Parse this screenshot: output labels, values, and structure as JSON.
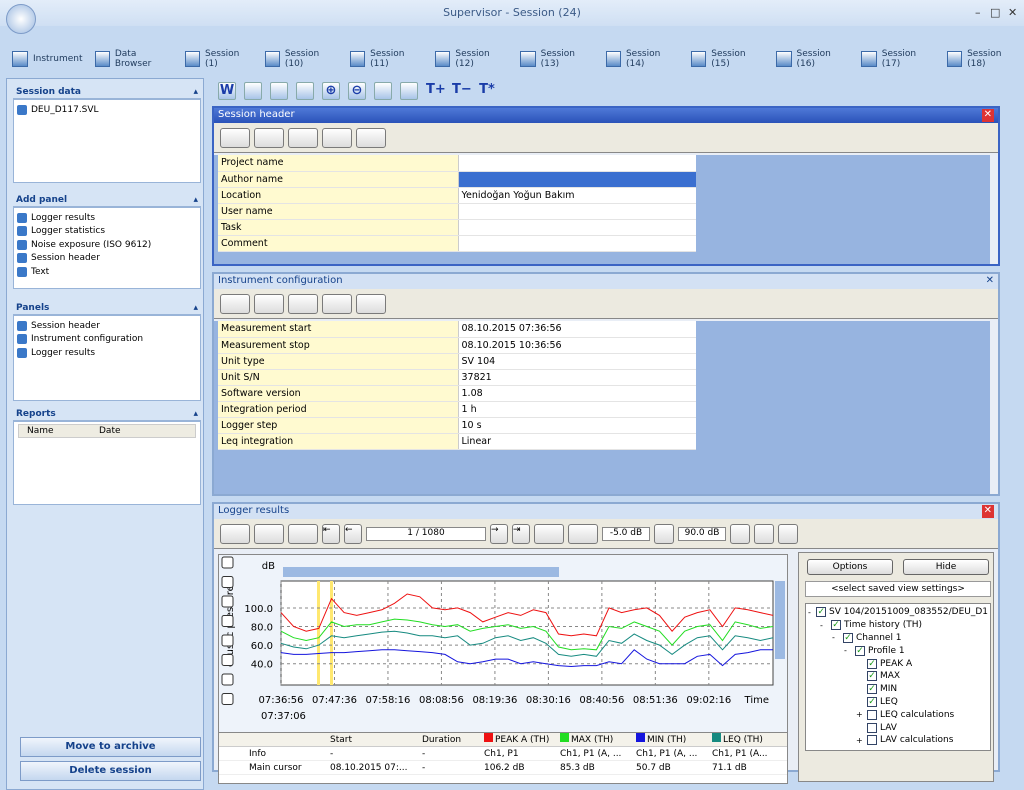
{
  "window": {
    "title": "Supervisor - Session (24)"
  },
  "tabs": [
    "Instrument",
    "Data Browser",
    "Session (1)",
    "Session (10)",
    "Session (11)",
    "Session (12)",
    "Session (13)",
    "Session (14)",
    "Session (15)",
    "Session (16)",
    "Session (17)",
    "Session (18)"
  ],
  "left": {
    "session_data": {
      "title": "Session data",
      "items": [
        "DEU_D117.SVL"
      ]
    },
    "add_panel": {
      "title": "Add panel",
      "items": [
        "Logger results",
        "Logger statistics",
        "Noise exposure (ISO 9612)",
        "Session header",
        "Text"
      ]
    },
    "panels": {
      "title": "Panels",
      "items": [
        "Session header",
        "Instrument configuration",
        "Logger results"
      ]
    },
    "reports": {
      "title": "Reports",
      "columns": [
        "Name",
        "Date"
      ]
    },
    "move_to_archive": "Move to archive",
    "delete_session": "Delete session"
  },
  "session_header": {
    "title": "Session header",
    "rows": [
      [
        "Project name",
        ""
      ],
      [
        "Author name",
        ""
      ],
      [
        "Location",
        "Yenidoğan Yoğun Bakım"
      ],
      [
        "User name",
        ""
      ],
      [
        "Task",
        ""
      ],
      [
        "Comment",
        ""
      ]
    ]
  },
  "instrument_config": {
    "title": "Instrument configuration",
    "rows": [
      [
        "Measurement start",
        "08.10.2015 07:36:56"
      ],
      [
        "Measurement stop",
        "08.10.2015 10:36:56"
      ],
      [
        "Unit type",
        "SV 104"
      ],
      [
        "Unit S/N",
        "37821"
      ],
      [
        "Software version",
        "1.08"
      ],
      [
        "Integration period",
        "1 h"
      ],
      [
        "Logger step",
        "10 s"
      ],
      [
        "Leq integration",
        "Linear"
      ]
    ]
  },
  "logger_results": {
    "title": "Logger results",
    "page": "1 / 1080",
    "min_db": "-5.0 dB",
    "max_db": "90.0 dB",
    "options": "Options",
    "hide": "Hide",
    "saved_view": "<select saved view settings>",
    "tree": [
      {
        "label": "SV 104/20151009_083552/DEU_D1",
        "level": 0,
        "checked": true,
        "exp": "-"
      },
      {
        "label": "Time history (TH)",
        "level": 1,
        "checked": true,
        "exp": "-"
      },
      {
        "label": "Channel 1",
        "level": 2,
        "checked": true,
        "exp": "-"
      },
      {
        "label": "Profile 1",
        "level": 3,
        "checked": true,
        "exp": "-"
      },
      {
        "label": "PEAK A",
        "level": 4,
        "checked": true,
        "exp": ""
      },
      {
        "label": "MAX",
        "level": 4,
        "checked": true,
        "exp": ""
      },
      {
        "label": "MIN",
        "level": 4,
        "checked": true,
        "exp": ""
      },
      {
        "label": "LEQ",
        "level": 4,
        "checked": true,
        "exp": ""
      },
      {
        "label": "LEQ calculations",
        "level": 4,
        "checked": false,
        "exp": "+"
      },
      {
        "label": "LAV",
        "level": 4,
        "checked": false,
        "exp": ""
      },
      {
        "label": "LAV calculations",
        "level": 4,
        "checked": false,
        "exp": "+"
      }
    ],
    "grid": {
      "columns": [
        "",
        "Start",
        "Duration",
        "PEAK A (TH)",
        "MAX (TH)",
        "MIN (TH)",
        "LEQ (TH)"
      ],
      "rows": [
        [
          "Info",
          "-",
          "-",
          "Ch1, P1",
          "Ch1, P1 (A, ...",
          "Ch1, P1 (A, ...",
          "Ch1, P1 (A..."
        ],
        [
          "Main cursor",
          "08.10.2015 07:...",
          "-",
          "106.2 dB",
          "85.3 dB",
          "50.7 dB",
          "71.1 dB"
        ]
      ]
    }
  },
  "chart_data": {
    "type": "line",
    "ylabel": "coustic pressure",
    "yunit": "dB",
    "xlabel": "Time",
    "ylim": [
      30,
      129
    ],
    "yticks": [
      "100.0",
      "80.0",
      "60.0",
      "40.0"
    ],
    "xticks": [
      "07:36:56",
      "07:47:36",
      "07:58:16",
      "08:08:56",
      "08:19:36",
      "08:30:16",
      "08:40:56",
      "08:51:36",
      "09:02:16"
    ],
    "cursor": "07:37:06",
    "grid": true,
    "series": [
      {
        "name": "PEAK A (TH)",
        "color": "#ee1111",
        "values": [
          95,
          80,
          75,
          78,
          110,
          95,
          92,
          95,
          98,
          105,
          115,
          112,
          100,
          98,
          100,
          95,
          85,
          90,
          95,
          92,
          98,
          95,
          72,
          70,
          72,
          70,
          100,
          95,
          98,
          100,
          92,
          75,
          90,
          95,
          98,
          80,
          100,
          98,
          95,
          92
        ]
      },
      {
        "name": "MAX (TH)",
        "color": "#22dd22",
        "values": [
          75,
          68,
          65,
          68,
          85,
          80,
          82,
          82,
          85,
          88,
          87,
          85,
          82,
          80,
          82,
          75,
          78,
          80,
          82,
          78,
          80,
          75,
          58,
          55,
          56,
          55,
          80,
          78,
          85,
          80,
          75,
          60,
          75,
          80,
          82,
          65,
          85,
          82,
          78,
          80
        ]
      },
      {
        "name": "MIN (TH)",
        "color": "#1515dd",
        "values": [
          52,
          50,
          50,
          51,
          52,
          52,
          53,
          54,
          55,
          55,
          54,
          53,
          52,
          50,
          42,
          40,
          42,
          45,
          45,
          40,
          42,
          40,
          38,
          37,
          38,
          38,
          42,
          40,
          55,
          45,
          40,
          40,
          40,
          48,
          50,
          38,
          50,
          52,
          55,
          55
        ]
      },
      {
        "name": "LEQ (TH)",
        "color": "#168a80",
        "values": [
          62,
          58,
          56,
          60,
          70,
          68,
          70,
          72,
          74,
          75,
          73,
          70,
          70,
          68,
          70,
          60,
          62,
          68,
          70,
          65,
          68,
          62,
          50,
          48,
          50,
          48,
          65,
          62,
          72,
          65,
          60,
          50,
          60,
          68,
          70,
          55,
          70,
          68,
          65,
          68
        ]
      }
    ]
  }
}
